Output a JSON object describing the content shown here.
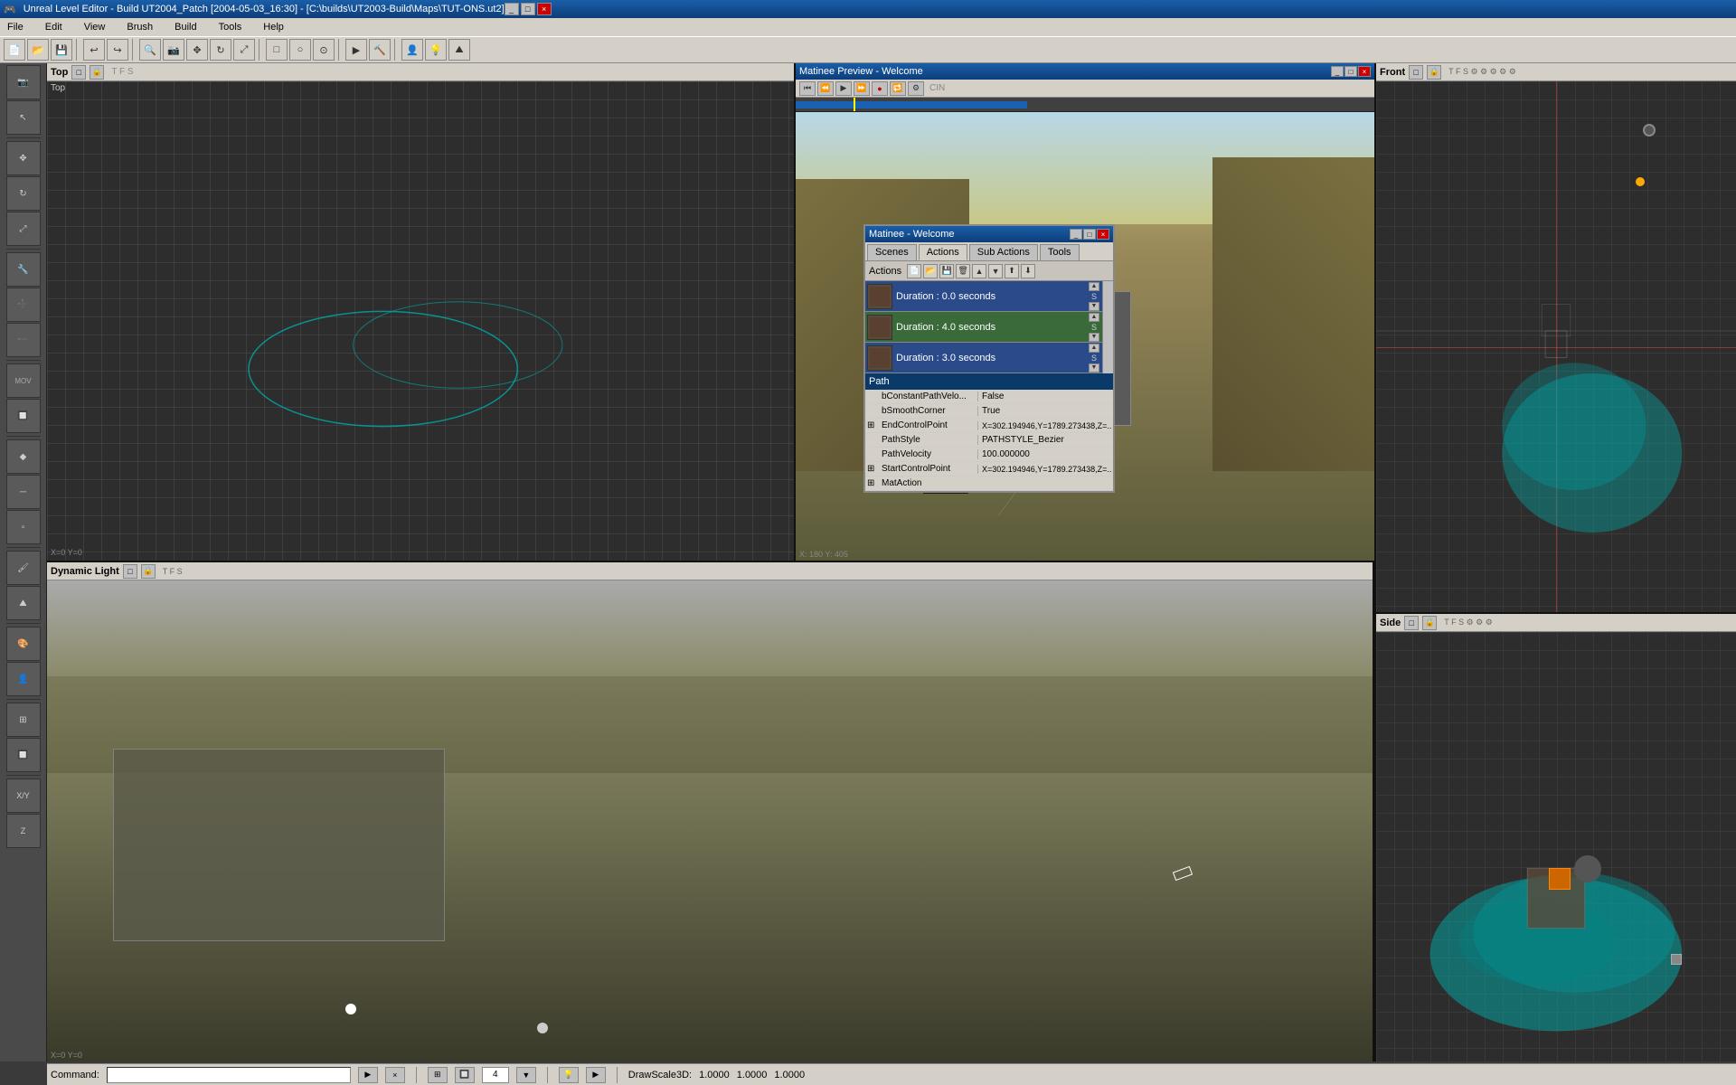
{
  "app": {
    "title": "Unreal Level Editor - Build UT2004_Patch  [2004-05-03_16:30] - [C:\\builds\\UT2003-Build\\Maps\\TUT-ONS.ut2]",
    "titlebar_controls": [
      "_",
      "□",
      "×"
    ]
  },
  "menubar": {
    "items": [
      "File",
      "Edit",
      "View",
      "Brush",
      "Build",
      "Tools",
      "Help"
    ]
  },
  "viewports": {
    "top_left": {
      "label": "Top",
      "type": "orthographic"
    },
    "matinee_preview": {
      "title": "Matinee Preview - Welcome",
      "controls": [
        "◀◀",
        "◀",
        "▶",
        "▶▶",
        "●"
      ]
    },
    "bottom_left": {
      "label": "Dynamic Light",
      "type": "perspective"
    },
    "front": {
      "label": "Front",
      "type": "orthographic"
    },
    "side": {
      "label": "Side",
      "type": "orthographic"
    }
  },
  "matinee_dialog": {
    "title": "Matinee - Welcome",
    "tabs": [
      "Scenes",
      "Actions",
      "Sub Actions",
      "Tools"
    ],
    "active_tab": "Actions",
    "actions_toolbar_label": "Actions",
    "toolbar_buttons": [
      "new",
      "open",
      "save",
      "delete",
      "move_up",
      "move_down",
      "import",
      "export"
    ],
    "action_items": [
      {
        "text": "Duration : 0.0 seconds",
        "bg": "blue",
        "scroll_top": "▲",
        "scroll_bot": "▼"
      },
      {
        "text": "Duration : 4.0 seconds",
        "bg": "green",
        "scroll_top": "▲",
        "scroll_bot": "▼"
      },
      {
        "text": "Duration : 3.0 seconds",
        "bg": "blue",
        "scroll_top": "▲",
        "scroll_bot": "▼"
      }
    ],
    "properties": {
      "header": "Path",
      "rows": [
        {
          "key": "bConstantPathVelo...",
          "value": "False",
          "expand": false
        },
        {
          "key": "bSmoothCorner",
          "value": "True",
          "expand": false
        },
        {
          "key": "EndControlPoint",
          "value": "X=302.194946,Y=1789.273438,Z=...",
          "expand": true
        },
        {
          "key": "PathStyle",
          "value": "PATHSTYLE_Bezier",
          "expand": false
        },
        {
          "key": "PathVelocity",
          "value": "100.000000",
          "expand": false
        },
        {
          "key": "StartControlPoint",
          "value": "X=302.194946,Y=1789.273438,Z=...",
          "expand": true
        },
        {
          "key": "MatAction",
          "value": "",
          "expand": true
        }
      ]
    }
  },
  "command_bar": {
    "label": "Command:",
    "placeholder": "",
    "draw_scale_label": "DrawScale3D:",
    "scale_x": "1.0000",
    "scale_y": "1.0000",
    "scale_z": "1.0000"
  },
  "statusbar": {
    "command_label": "Command:"
  }
}
